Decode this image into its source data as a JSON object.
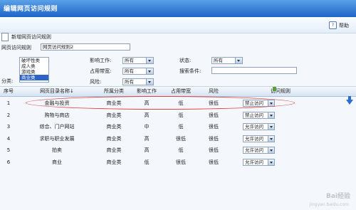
{
  "window": {
    "title": "编辑网页访问规则"
  },
  "toolbar": {
    "help_label": "帮助"
  },
  "new_rule": {
    "label": "新增网页访问规则"
  },
  "form": {
    "rule_name_label": "网页访问规则",
    "rule_name_value": "网页访问规则2",
    "category_label": "分类:",
    "category_options": [
      "破坏性类",
      "成人类",
      "游戏类",
      "商业类"
    ],
    "category_selected": "商业类",
    "impact_label": "影响工作:",
    "impact_value": "所有",
    "bandwidth_label": "占用带宽:",
    "bandwidth_value": "所有",
    "risk_label": "风险:",
    "risk_value": "所有",
    "status_label": "状态:",
    "status_value": "所有",
    "search_label": "搜索条件:",
    "search_value": ""
  },
  "table": {
    "columns": [
      "序号",
      "网页目录名称↓",
      "所属分类",
      "影响工作",
      "占用带宽",
      "风险",
      "访问规则"
    ],
    "rows": [
      {
        "no": "1",
        "name": "金融与投资",
        "category": "商业类",
        "impact": "高",
        "bandwidth": "低",
        "risk": "很低",
        "rule": "禁止访问"
      },
      {
        "no": "2",
        "name": "购物与商店",
        "category": "商业类",
        "impact": "高",
        "bandwidth": "低",
        "risk": "很低",
        "rule": "禁止访问"
      },
      {
        "no": "3",
        "name": "综合、门户网站",
        "category": "商业类",
        "impact": "中",
        "bandwidth": "低",
        "risk": "很低",
        "rule": "允许访问"
      },
      {
        "no": "4",
        "name": "求职与职业发展",
        "category": "商业类",
        "impact": "高",
        "bandwidth": "很低",
        "risk": "很低",
        "rule": "允许访问"
      },
      {
        "no": "5",
        "name": "拍卖",
        "category": "商业类",
        "impact": "高",
        "bandwidth": "低",
        "risk": "很低",
        "rule": "允许访问"
      },
      {
        "no": "6",
        "name": "商业",
        "category": "商业类",
        "impact": "低",
        "bandwidth": "很低",
        "risk": "很低",
        "rule": "允许访问"
      }
    ]
  },
  "watermark": {
    "main": "Bai经验",
    "sub": "jingyan.baidu.com"
  },
  "colors": {
    "titlebar": "#1d64c8",
    "highlight_ellipse": "#e04040",
    "selected_item": "#2c63c7"
  }
}
